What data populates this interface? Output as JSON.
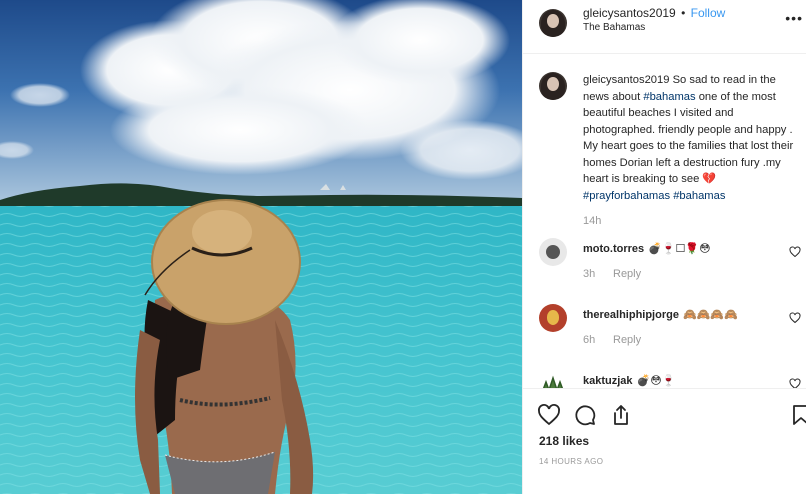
{
  "post": {
    "username": "gleicysantos2019",
    "separator": "•",
    "follow_label": "Follow",
    "location": "The Bahamas",
    "more_icon": "more-horizontal-icon"
  },
  "caption": {
    "username": "gleicysantos2019",
    "text_1": "So sad to read in the news about",
    "hashtag_1": "#bahamas",
    "text_2": "one of the most beautiful beaches I visited and photographed. friendly people and happy . My heart goes to the families that lost their homes Dorian left a destruction fury .my heart is breaking to see 💔",
    "hashtag_2": "#prayforbahamas",
    "hashtag_3": "#bahamas",
    "time": "14h"
  },
  "comments": [
    {
      "username": "moto.torres",
      "emoji": "💣🍷☐🌹😳",
      "time": "3h",
      "reply_label": "Reply"
    },
    {
      "username": "therealhiphipjorge",
      "emoji": "🙈🙈🙈🙈",
      "time": "6h",
      "reply_label": "Reply"
    },
    {
      "username": "kaktuzjak",
      "emoji": "💣😳🍷",
      "time": "",
      "reply_label": ""
    }
  ],
  "actions": {
    "like_icon": "heart-icon",
    "comment_icon": "comment-icon",
    "share_icon": "share-icon",
    "save_icon": "bookmark-icon"
  },
  "likes": "218 likes",
  "posted_ago": "14 HOURS AGO",
  "colors": {
    "link": "#3897f0",
    "hashtag": "#003569",
    "muted": "#999999",
    "text": "#262626",
    "sea": "#3cb7c4"
  }
}
